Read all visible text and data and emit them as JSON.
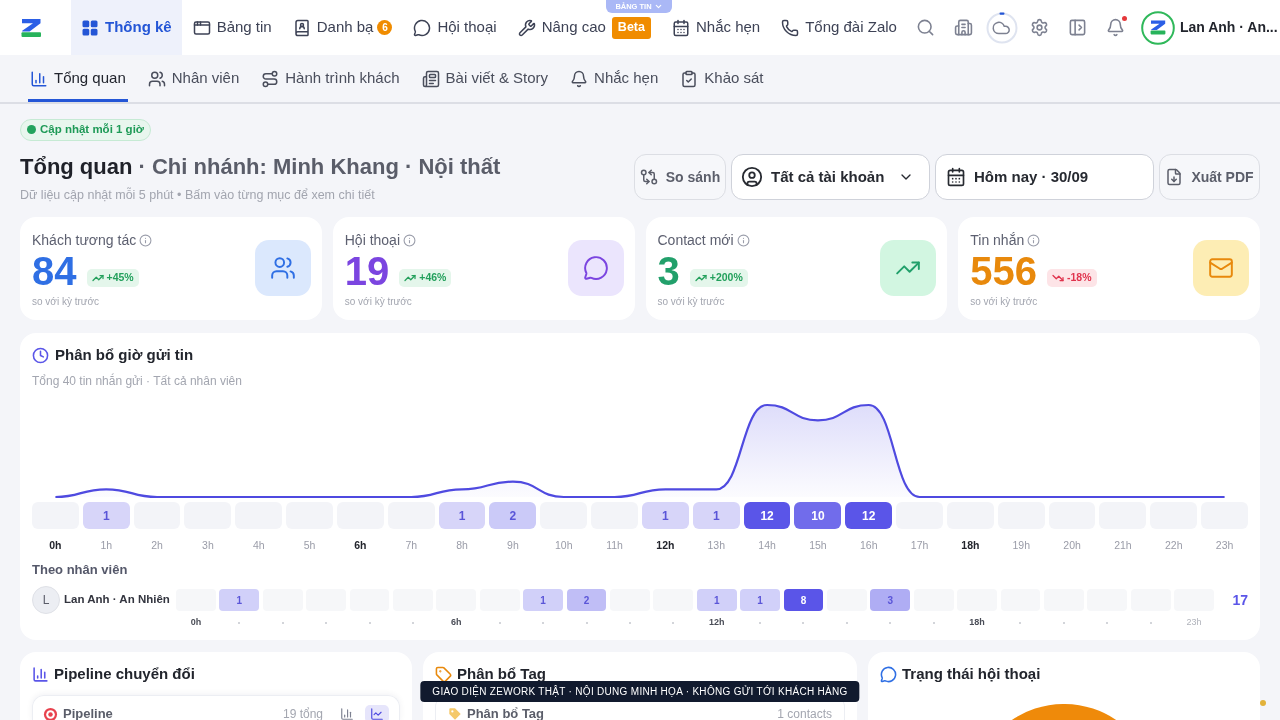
{
  "top_nav": {
    "news_tab": "BẢNG TIN",
    "tabs": [
      {
        "label": "Thống kê",
        "selected": true
      },
      {
        "label": "Bảng tin",
        "selected": false
      },
      {
        "label": "Danh bạ",
        "badge": "6",
        "selected": false
      },
      {
        "label": "Hội thoại",
        "selected": false
      },
      {
        "label": "Nâng cao",
        "tag": "Beta",
        "selected": false
      },
      {
        "label": "Nhắc hẹn",
        "selected": false
      },
      {
        "label": "Tổng đài Zalo",
        "selected": false
      }
    ],
    "notifications_unread": true,
    "user": "Lan Anh · An..."
  },
  "sub_nav": {
    "tabs": [
      {
        "label": "Tổng quan",
        "selected": true
      },
      {
        "label": "Nhân viên",
        "selected": false
      },
      {
        "label": "Hành trình khách",
        "selected": false
      },
      {
        "label": "Bài viết & Story",
        "selected": false
      },
      {
        "label": "Nhắc hẹn",
        "selected": false
      },
      {
        "label": "Khảo sát",
        "selected": false
      }
    ]
  },
  "header": {
    "update_badge": "Cập nhật mỗi 1 giờ",
    "title": "Tổng quan",
    "context": "· Chi nhánh: Minh Khang · Nội thất",
    "description": "Dữ liệu cập nhật mỗi 5 phút • Bấm vào từng mục để xem chi tiết",
    "actions": {
      "compare": "So sánh",
      "account_filter": "Tất cả tài khoản",
      "date_filter": "Hôm nay · 30/09",
      "export": "Xuất PDF"
    }
  },
  "stats": [
    {
      "label": "Khách tương tác",
      "value": "84",
      "change": "+45%",
      "rising": true,
      "note": "so với kỳ trước",
      "color": "#2f6fe4"
    },
    {
      "label": "Hội thoại",
      "value": "19",
      "change": "+46%",
      "rising": true,
      "note": "so với kỳ trước",
      "color": "#7b45e0"
    },
    {
      "label": "Contact mới",
      "value": "3",
      "change": "+200%",
      "rising": true,
      "note": "so với kỳ trước",
      "color": "#22a06b"
    },
    {
      "label": "Tin nhắn",
      "value": "556",
      "change": "-18%",
      "rising": false,
      "note": "so với kỳ trước",
      "color": "#e8890c"
    }
  ],
  "hourly_chart": {
    "title": "Phân bổ giờ gửi tin",
    "subtitle": "Tổng 40 tin nhắn gửi · Tất cả nhân viên",
    "chart_data": {
      "type": "area",
      "categories": [
        "0h",
        "1h",
        "2h",
        "3h",
        "4h",
        "5h",
        "6h",
        "7h",
        "8h",
        "9h",
        "10h",
        "11h",
        "12h",
        "13h",
        "14h",
        "15h",
        "16h",
        "17h",
        "18h",
        "19h",
        "20h",
        "21h",
        "22h",
        "23h"
      ],
      "values": [
        0,
        1,
        0,
        0,
        0,
        0,
        0,
        0,
        1,
        2,
        0,
        0,
        1,
        1,
        12,
        10,
        12,
        0,
        0,
        0,
        0,
        0,
        0,
        0
      ],
      "value_labels": [
        null,
        "1",
        null,
        null,
        null,
        null,
        null,
        null,
        "1",
        "2",
        null,
        null,
        "1",
        "1",
        "12",
        "10",
        "12",
        null,
        null,
        null,
        null,
        null,
        null,
        null
      ]
    },
    "axis_marks": [
      {
        "major": true
      },
      {
        "major": false
      },
      {
        "major": false
      },
      {
        "major": false
      },
      {
        "major": false
      },
      {
        "major": false
      },
      {
        "major": true
      },
      {
        "major": false
      },
      {
        "major": false
      },
      {
        "major": false
      },
      {
        "major": false
      },
      {
        "major": false
      },
      {
        "major": true
      },
      {
        "major": false
      },
      {
        "major": false
      },
      {
        "major": false
      },
      {
        "major": false
      },
      {
        "major": false
      },
      {
        "major": true
      },
      {
        "major": false
      },
      {
        "major": false
      },
      {
        "major": false
      },
      {
        "major": false
      },
      {
        "major": false
      }
    ]
  },
  "staff": {
    "title": "Theo nhân viên",
    "rows": [
      {
        "initial": "L",
        "name": "Lan Anh · An Nhiên",
        "cells": [
          {
            "filled": false
          },
          {
            "filled": true,
            "count": "1"
          },
          {
            "filled": false
          },
          {
            "filled": false
          },
          {
            "filled": false
          },
          {
            "filled": false
          },
          {
            "filled": false
          },
          {
            "filled": false
          },
          {
            "filled": true,
            "count": "1"
          },
          {
            "filled": true,
            "count": "2"
          },
          {
            "filled": false
          },
          {
            "filled": false
          },
          {
            "filled": true,
            "count": "1"
          },
          {
            "filled": true,
            "count": "1"
          },
          {
            "filled": true,
            "count": "8"
          },
          {
            "filled": false
          },
          {
            "filled": true,
            "count": "3"
          },
          {
            "filled": false
          },
          {
            "filled": false
          },
          {
            "filled": false
          },
          {
            "filled": false
          },
          {
            "filled": false
          },
          {
            "filled": false
          },
          {
            "filled": false
          }
        ],
        "total": "17"
      }
    ],
    "axis": [
      {
        "kind": "major",
        "label": "0h"
      },
      {
        "kind": "dot"
      },
      {
        "kind": "dot"
      },
      {
        "kind": "dot"
      },
      {
        "kind": "dot"
      },
      {
        "kind": "dot"
      },
      {
        "kind": "major",
        "label": "6h"
      },
      {
        "kind": "dot"
      },
      {
        "kind": "dot"
      },
      {
        "kind": "dot"
      },
      {
        "kind": "dot"
      },
      {
        "kind": "dot"
      },
      {
        "kind": "major",
        "label": "12h"
      },
      {
        "kind": "dot"
      },
      {
        "kind": "dot"
      },
      {
        "kind": "dot"
      },
      {
        "kind": "dot"
      },
      {
        "kind": "dot"
      },
      {
        "kind": "major",
        "label": "18h"
      },
      {
        "kind": "dot"
      },
      {
        "kind": "dot"
      },
      {
        "kind": "dot"
      },
      {
        "kind": "dot"
      },
      {
        "kind": "minor",
        "label": "23h"
      }
    ]
  },
  "bottom_cards": [
    {
      "kind": "pipeline",
      "title": "Pipeline chuyển đổi",
      "inner_title": "Pipeline",
      "inner_meta": "19 tổng",
      "view_toggles": [
        {
          "selected": false
        },
        {
          "selected": true
        }
      ]
    },
    {
      "kind": "tags",
      "title": "Phân bổ Tag",
      "inner_title": "Phân bổ Tag",
      "inner_meta": "1 contacts"
    },
    {
      "kind": "status",
      "title": "Trạng thái hội thoại"
    }
  ],
  "demo_banner": "GIAO DIỆN ZEWORK THẬT · NỘI DUNG MINH HỌA · KHÔNG GỬI TỚI KHÁCH HÀNG"
}
